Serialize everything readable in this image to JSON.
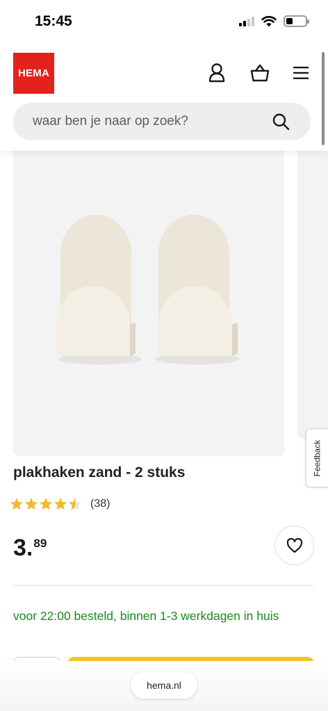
{
  "status_bar": {
    "time": "15:45"
  },
  "header": {
    "logo_text": "HEMA",
    "account_icon": "account-icon",
    "basket_icon": "basket-icon",
    "menu_icon": "menu-icon",
    "search": {
      "placeholder": "waar ben je naar op zoek?",
      "value": "",
      "icon": "search-icon"
    }
  },
  "product": {
    "title": "plakhaken zand - 2 stuks",
    "rating": 4.5,
    "review_count": "(38)",
    "price_int": "3.",
    "price_dec": "89",
    "favorite_icon": "heart-icon",
    "delivery_text": "voor 22:00 besteld, binnen 1-3 werkdagen in huis"
  },
  "feedback": {
    "label": "Feedback"
  },
  "browser": {
    "url": "hema.nl"
  },
  "colors": {
    "brand_red": "#e3221c",
    "accent_yellow": "#f6c325",
    "star_yellow": "#f5b731",
    "delivery_green": "#1a8a1a",
    "image_bg": "#f3f3f3"
  }
}
